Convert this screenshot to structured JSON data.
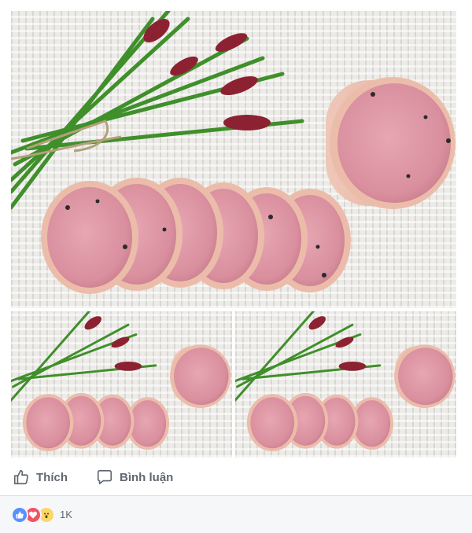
{
  "post": {
    "photos": [
      {
        "name": "sliced-sausage-photo"
      },
      {
        "name": "sliced-sausage-photo-variant-1"
      },
      {
        "name": "sliced-sausage-photo-variant-2"
      }
    ]
  },
  "actions": {
    "like_label": "Thích",
    "like_icon": "thumbs-up-outline-icon",
    "comment_label": "Bình luận",
    "comment_icon": "speech-bubble-outline-icon"
  },
  "reactions": {
    "icons": [
      "like-reaction-icon",
      "love-reaction-icon",
      "wow-reaction-icon"
    ],
    "count": "1K"
  },
  "colors": {
    "action_text": "#606770",
    "reaction_bar_bg": "#f6f7f9",
    "like_blue": "#5890ff",
    "love_red": "#f25268",
    "wow_yellow": "#fcd669",
    "divider": "#dddfe2"
  }
}
